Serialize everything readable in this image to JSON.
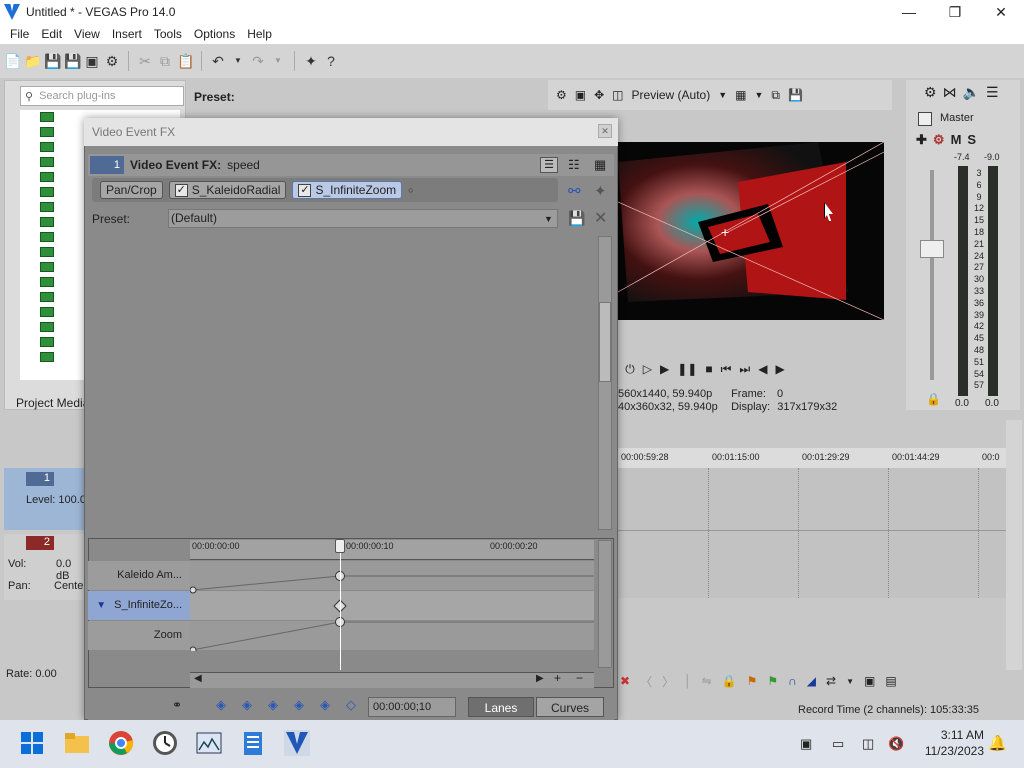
{
  "window": {
    "title": "Untitled * - VEGAS Pro 14.0"
  },
  "menu": [
    "File",
    "Edit",
    "View",
    "Insert",
    "Tools",
    "Options",
    "Help"
  ],
  "plugins": {
    "search_placeholder": "Search plug-ins",
    "preset_label": "Preset:",
    "project_media_tab": "Project Media"
  },
  "preview": {
    "mode": "Preview (Auto)",
    "line1": "560x1440, 59.940p",
    "line2": "40x360x32, 59.940p",
    "frame_label": "Frame:",
    "frame_value": "0",
    "display_label": "Display:",
    "display_value": "317x179x32"
  },
  "master": {
    "title": "Master",
    "mute": "M",
    "solo": "S",
    "peak_left": "-7.4",
    "peak_right": "-9.0",
    "ticks": [
      "3",
      "6",
      "9",
      "12",
      "15",
      "18",
      "21",
      "24",
      "27",
      "30",
      "33",
      "36",
      "39",
      "42",
      "45",
      "48",
      "51",
      "54",
      "57"
    ],
    "val_left": "0.0",
    "val_right": "0.0"
  },
  "timeline": {
    "ticks": [
      "00:00:59:28",
      "00:01:15:00",
      "00:01:29:29",
      "00:01:44:29",
      "00:0"
    ],
    "rate": "Rate: 0.00",
    "record_time": "Record Time (2 channels): 105:33:35"
  },
  "tracks": [
    {
      "num": "1",
      "level": "Level: 100.0"
    },
    {
      "num": "2",
      "vol_label": "Vol:",
      "vol": "0.0 dB",
      "pan_label": "Pan:",
      "pan": "Cente"
    }
  ],
  "dialog": {
    "title": "Video Event FX",
    "track_num": "1",
    "fx_label": "Video Event FX:",
    "fx_name": "speed",
    "chain": [
      {
        "label": "Pan/Crop",
        "checked": false,
        "selected": false
      },
      {
        "label": "S_KaleidoRadial",
        "checked": true,
        "selected": false
      },
      {
        "label": "S_InfiniteZoom",
        "checked": true,
        "selected": true
      }
    ],
    "preset_label": "Preset:",
    "preset_value": "(Default)",
    "kf_ticks": [
      "00:00:00:00",
      "00:00:00:10",
      "00:00:00:20"
    ],
    "kf_rows": [
      "Kaleido Am...",
      "S_InfiniteZo...",
      "Zoom"
    ],
    "kf_time": "00:00:00;10",
    "lanes": "Lanes",
    "curves": "Curves"
  },
  "taskbar": {
    "time": "3:11 AM",
    "date": "11/23/2023"
  }
}
